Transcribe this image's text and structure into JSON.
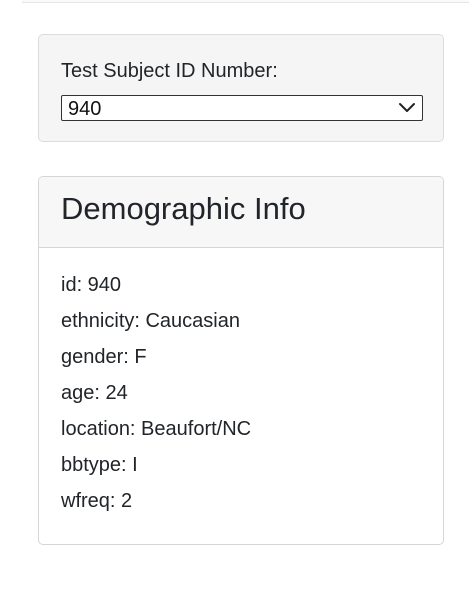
{
  "selector": {
    "label": "Test Subject ID Number:",
    "selected_value": "940",
    "icon": "chevron-down-icon"
  },
  "panel": {
    "title": "Demographic Info",
    "lines": [
      "id: 940",
      "ethnicity: Caucasian",
      "gender: F",
      "age: 24",
      "location: Beaufort/NC",
      "bbtype: I",
      "wfreq: 2"
    ]
  },
  "colors": {
    "well_background": "#f5f5f5",
    "card_header_background": "#f7f7f7",
    "border": "#d6d6d6",
    "text": "#212529"
  }
}
